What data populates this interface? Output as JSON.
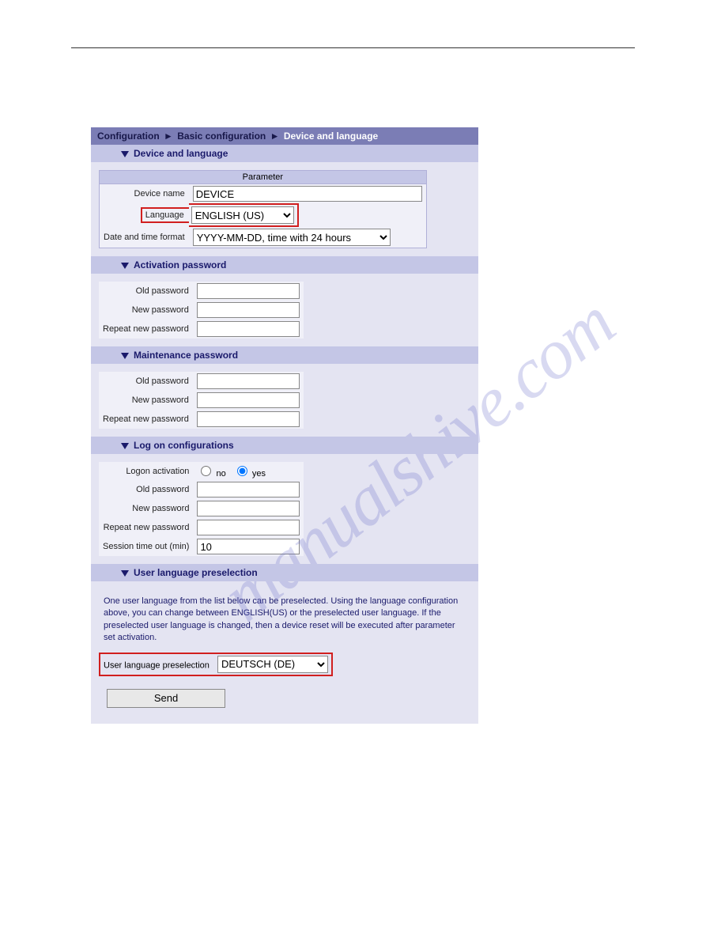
{
  "breadcrumb": {
    "a": "Configuration",
    "b": "Basic configuration",
    "c": "Device and language"
  },
  "sections": {
    "device": {
      "title": "Device and language",
      "param_header": "Parameter",
      "device_name_label": "Device name",
      "device_name_value": "DEVICE",
      "language_label": "Language",
      "language_value": "ENGLISH (US)",
      "datetime_label": "Date and time format",
      "datetime_value": "YYYY-MM-DD, time with 24 hours"
    },
    "activation": {
      "title": "Activation password",
      "old_label": "Old password",
      "new_label": "New password",
      "repeat_label": "Repeat new password"
    },
    "maintenance": {
      "title": "Maintenance password",
      "old_label": "Old password",
      "new_label": "New password",
      "repeat_label": "Repeat new password"
    },
    "logon": {
      "title": "Log on configurations",
      "activation_label": "Logon activation",
      "radio_no": "no",
      "radio_yes": "yes",
      "old_label": "Old password",
      "new_label": "New password",
      "repeat_label": "Repeat new password",
      "timeout_label": "Session time out (min)",
      "timeout_value": "10"
    },
    "userlang": {
      "title": "User language preselection",
      "desc": "One user language from the list below can be preselected. Using the language configuration above, you can change between ENGLISH(US) or the preselected user language. If the preselected user language is changed, then a device reset will be executed after parameter set activation.",
      "label": "User language preselection",
      "value": "DEUTSCH (DE)"
    }
  },
  "send_label": "Send",
  "watermark": "manualshive.com"
}
